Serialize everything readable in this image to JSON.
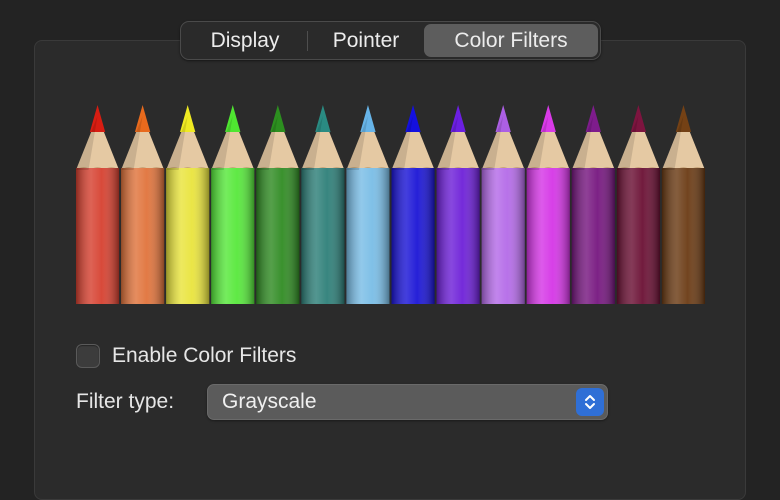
{
  "tabs": [
    {
      "label": "Display",
      "selected": false
    },
    {
      "label": "Pointer",
      "selected": false
    },
    {
      "label": "Color Filters",
      "selected": true
    }
  ],
  "pencils": [
    {
      "name": "red",
      "color": "#d6402f",
      "tip": "#d81d12"
    },
    {
      "name": "orange",
      "color": "#e0733b",
      "tip": "#e86a1d"
    },
    {
      "name": "yellow",
      "color": "#e9e43c",
      "tip": "#efea22"
    },
    {
      "name": "light-green",
      "color": "#56e83a",
      "tip": "#4fe631"
    },
    {
      "name": "dark-green",
      "color": "#2f8b22",
      "tip": "#2c8f1f"
    },
    {
      "name": "teal",
      "color": "#2d7f78",
      "tip": "#2a8b82"
    },
    {
      "name": "sky-blue",
      "color": "#79bde6",
      "tip": "#67b4e8"
    },
    {
      "name": "blue",
      "color": "#1a14d6",
      "tip": "#1410e0"
    },
    {
      "name": "violet",
      "color": "#6d1fd8",
      "tip": "#6c1fe2"
    },
    {
      "name": "lavender",
      "color": "#b46ae8",
      "tip": "#ac5fe4"
    },
    {
      "name": "magenta",
      "color": "#d535e6",
      "tip": "#d93ae8"
    },
    {
      "name": "purple",
      "color": "#76167f",
      "tip": "#7e1c8c"
    },
    {
      "name": "maroon",
      "color": "#6a0f33",
      "tip": "#7d143f"
    },
    {
      "name": "brown",
      "color": "#6a3a13",
      "tip": "#744115"
    }
  ],
  "wood_color": "#e5c9a3",
  "enable_label": "Enable Color Filters",
  "enable_checked": false,
  "filter_type_label": "Filter type:",
  "filter_type_value": "Grayscale",
  "accent_color": "#2f6fd6"
}
